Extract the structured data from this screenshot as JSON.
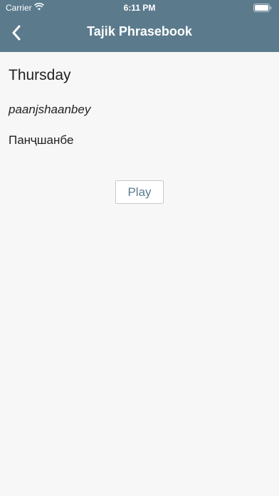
{
  "status_bar": {
    "carrier": "Carrier",
    "time": "6:11 PM",
    "icons": [
      "wifi-icon",
      "battery-icon"
    ]
  },
  "nav": {
    "title": "Tajik Phrasebook",
    "back_icon": "chevron-left-icon"
  },
  "phrase": {
    "english": "Thursday",
    "transliteration": "paanjshaanbey",
    "native": "Панҷшанбе"
  },
  "actions": {
    "play_label": "Play"
  },
  "colors": {
    "header": "#5b7b8d",
    "background": "#f7f7f7",
    "accent": "#5b7b8d"
  }
}
